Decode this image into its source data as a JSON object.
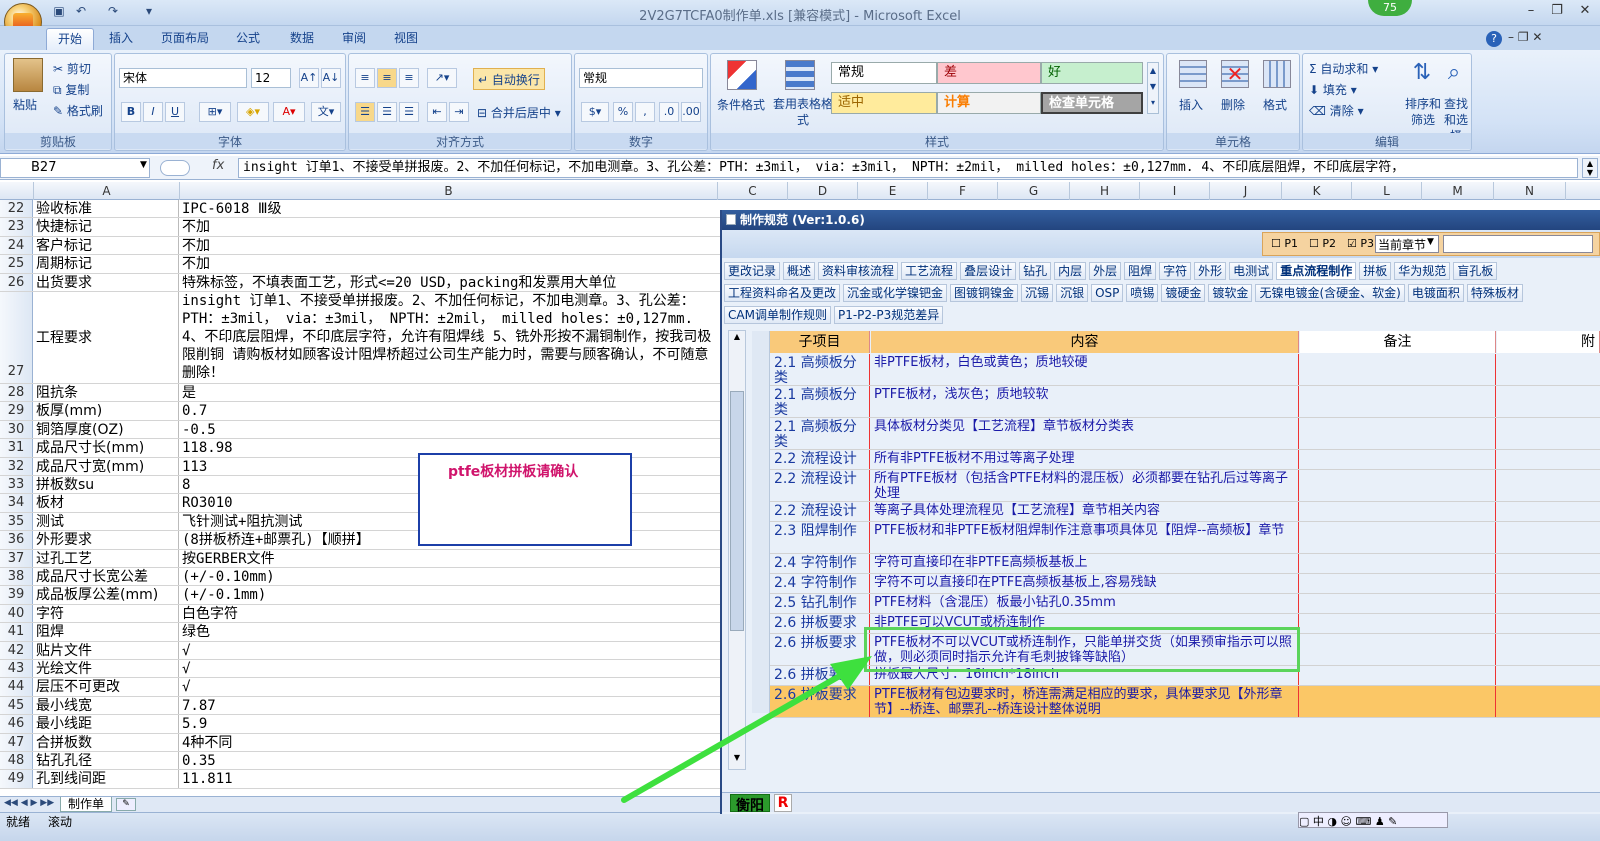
{
  "window": {
    "title": "2V2G7TCFA0制作单.xls [兼容模式] - Microsoft Excel",
    "badge": "75"
  },
  "qat": [
    "save-icon",
    "undo-icon",
    "redo-icon",
    "customize-icon"
  ],
  "tabs": [
    "开始",
    "插入",
    "页面布局",
    "公式",
    "数据",
    "审阅",
    "视图"
  ],
  "ribbon": {
    "clipboard": {
      "label": "剪贴板",
      "paste": "粘贴",
      "cut": "剪切",
      "copy": "复制",
      "format_painter": "格式刷"
    },
    "font": {
      "label": "字体",
      "name": "宋体",
      "size": "12",
      "bold": "B",
      "italic": "I",
      "underline": "U"
    },
    "align": {
      "label": "对齐方式",
      "wrap": "自动换行",
      "merge": "合并后居中"
    },
    "number": {
      "label": "数字",
      "format": "常规"
    },
    "styles": {
      "label": "样式",
      "cond": "条件格式",
      "table": "套用表格格式",
      "cells": [
        "常规",
        "差",
        "好",
        "适中",
        "计算",
        "检查单元格"
      ]
    },
    "cellgroup": {
      "label": "单元格",
      "insert": "插入",
      "delete": "删除",
      "format": "格式"
    },
    "edit": {
      "label": "编辑",
      "autosum": "自动求和",
      "fill": "填充",
      "clear": "清除",
      "sort": "排序和筛选",
      "find": "查找和选择"
    }
  },
  "formula_bar": {
    "cell": "B27",
    "fx": "fx",
    "content": "insight 订单1、不接受单拼报废。2、不加任何标记，不加电测章。3、孔公差：PTH：±3mil， via：±3mil， NPTH：±2mil， milled holes：±0,127mm. 4、不印底层阻焊，不印底层字符，"
  },
  "columns": [
    "A",
    "B",
    "C",
    "D",
    "E",
    "F",
    "G",
    "H",
    "I",
    "J",
    "K",
    "L",
    "M",
    "N"
  ],
  "rows": [
    {
      "n": "22",
      "a": "验收标准",
      "b": "IPC-6018 Ⅲ级"
    },
    {
      "n": "23",
      "a": "快捷标记",
      "b": "不加"
    },
    {
      "n": "24",
      "a": "客户标记",
      "b": "不加"
    },
    {
      "n": "25",
      "a": "周期标记",
      "b": "不加"
    },
    {
      "n": "26",
      "a": "出货要求",
      "b": "特殊标签，不填表面工艺，形式<=20 USD，packing和发票用大单位"
    },
    {
      "n": "27",
      "a": "工程要求",
      "b": "insight 订单1、不接受单拼报废。2、不加任何标记，不加电测章。3、孔公差：PTH：±3mil， via：±3mil， NPTH：±2mil， milled holes：±0,127mm. 4、不印底层阻焊，不印底层字符，允许有阻焊线 5、铣外形按不漏铜制作，按我司极限削铜 请购板材如顾客设计阻焊桥超过公司生产能力时，需要与顾客确认，不可随意删除！"
    },
    {
      "n": "28",
      "a": "阻抗条",
      "b": "是"
    },
    {
      "n": "29",
      "a": "板厚(mm)",
      "b": "0.7"
    },
    {
      "n": "30",
      "a": "铜箔厚度(OZ)",
      "b": "-0.5"
    },
    {
      "n": "31",
      "a": "成品尺寸长(mm)",
      "b": "118.98"
    },
    {
      "n": "32",
      "a": "成品尺寸宽(mm)",
      "b": "113"
    },
    {
      "n": "33",
      "a": "拼板数su",
      "b": "8"
    },
    {
      "n": "34",
      "a": "板材",
      "b": "RO3010"
    },
    {
      "n": "35",
      "a": "测试",
      "b": "飞针测试+阻抗测试"
    },
    {
      "n": "36",
      "a": "外形要求",
      "b": "(8拼板桥连+邮票孔)【顺拼】"
    },
    {
      "n": "37",
      "a": "过孔工艺",
      "b": "按GERBER文件"
    },
    {
      "n": "38",
      "a": "成品尺寸长宽公差",
      "b": "(+/-0.10mm)"
    },
    {
      "n": "39",
      "a": "成品板厚公差(mm)",
      "b": "(+/-0.1mm)"
    },
    {
      "n": "40",
      "a": "字符",
      "b": "白色字符"
    },
    {
      "n": "41",
      "a": "阻焊",
      "b": "绿色"
    },
    {
      "n": "42",
      "a": "贴片文件",
      "b": "√"
    },
    {
      "n": "43",
      "a": "光绘文件",
      "b": "√"
    },
    {
      "n": "44",
      "a": "层压不可更改",
      "b": "√"
    },
    {
      "n": "45",
      "a": "最小线宽",
      "b": "7.87"
    },
    {
      "n": "46",
      "a": "最小线距",
      "b": "5.9"
    },
    {
      "n": "47",
      "a": "合拼板数",
      "b": "4种不同"
    },
    {
      "n": "48",
      "a": "钻孔孔径",
      "b": "0.35"
    },
    {
      "n": "49",
      "a": "孔到线间距",
      "b": "11.811"
    }
  ],
  "textbox": "ptfe板材拼板请确认",
  "sheet_tab": "制作单",
  "status": {
    "ready": "就绪",
    "scroll": "滚动"
  },
  "panel": {
    "title": "制作规范 (Ver:1.0.6)",
    "filters": {
      "p1": "P1",
      "p2": "P2",
      "p3": "P3",
      "scope": "当前章节"
    },
    "tabs1": [
      "更改记录",
      "概述",
      "资料审核流程",
      "工艺流程",
      "叠层设计",
      "钻孔",
      "内层",
      "外层",
      "阻焊",
      "字符",
      "外形",
      "电测试",
      "重点流程制作",
      "拼板",
      "华为规范",
      "盲孔板"
    ],
    "tabs2": [
      "工程资料命名及更改",
      "沉金或化学镍钯金",
      "图镀铜镍金",
      "沉锡",
      "沉银",
      "OSP",
      "喷锡",
      "镀硬金",
      "镀软金",
      "无镍电镀金(含硬金、软金)",
      "电镀面积",
      "特殊板材"
    ],
    "tabs3": [
      "CAM调单制作规则",
      "P1-P2-P3规范差异"
    ],
    "headers": [
      "子项目",
      "内容",
      "备注",
      "附"
    ],
    "rows": [
      {
        "sub": "2.1 高频板分类",
        "content": "非PTFE板材，白色或黄色；质地较硬"
      },
      {
        "sub": "2.1 高频板分类",
        "content": "PTFE板材，浅灰色；质地较软"
      },
      {
        "sub": "2.1 高频板分类",
        "content": "具体板材分类见【工艺流程】章节板材分类表"
      },
      {
        "sub": "2.2 流程设计",
        "content": "所有非PTFE板材不用过等离子处理"
      },
      {
        "sub": "2.2 流程设计",
        "content": "所有PTFE板材（包括含PTFE材料的混压板）必须都要在钻孔后过等离子处理"
      },
      {
        "sub": "2.2 流程设计",
        "content": "等离子具体处理流程见【工艺流程】章节相关内容"
      },
      {
        "sub": "2.3 阻焊制作",
        "content": "PTFE板材和非PTFE板材阻焊制作注意事项具体见【阻焊--高频板】章节"
      },
      {
        "sub": "2.4 字符制作",
        "content": "字符可直接印在非PTFE高频板基板上"
      },
      {
        "sub": "2.4 字符制作",
        "content": "字符不可以直接印在PTFE高频板基板上,容易残缺"
      },
      {
        "sub": "2.5 钻孔制作",
        "content": "PTFE材料（含混压）板最小钻孔0.35mm"
      },
      {
        "sub": "2.6 拼板要求",
        "content": "非PTFE可以VCUT或桥连制作"
      },
      {
        "sub": "2.6 拼板要求",
        "content": "PTFE板材不可以VCUT或桥连制作，只能单拼交货（如果预审指示可以照做，则必须同时指示允许有毛刺披锋等缺陷）"
      },
      {
        "sub": "2.6 拼板要求",
        "content": "拼板最大尺寸：16inch*18inch"
      },
      {
        "sub": "2.6 拼板要求",
        "content": "PTFE板材有包边要求时，桥连需满足相应的要求，具体要求见【外形章节】--桥连、邮票孔--桥连设计整体说明"
      }
    ],
    "bottom": {
      "tab": "衡阳",
      "r": "R"
    }
  },
  "colors": {
    "ribbon": "#d3e2f6",
    "panel_header": "#23457f",
    "table_header": "#f9c97a",
    "highlight": "#fbc766",
    "annotation": "#5bd45b",
    "textbox_border": "#1c3fa8",
    "textbox_text": "#d0146c"
  }
}
